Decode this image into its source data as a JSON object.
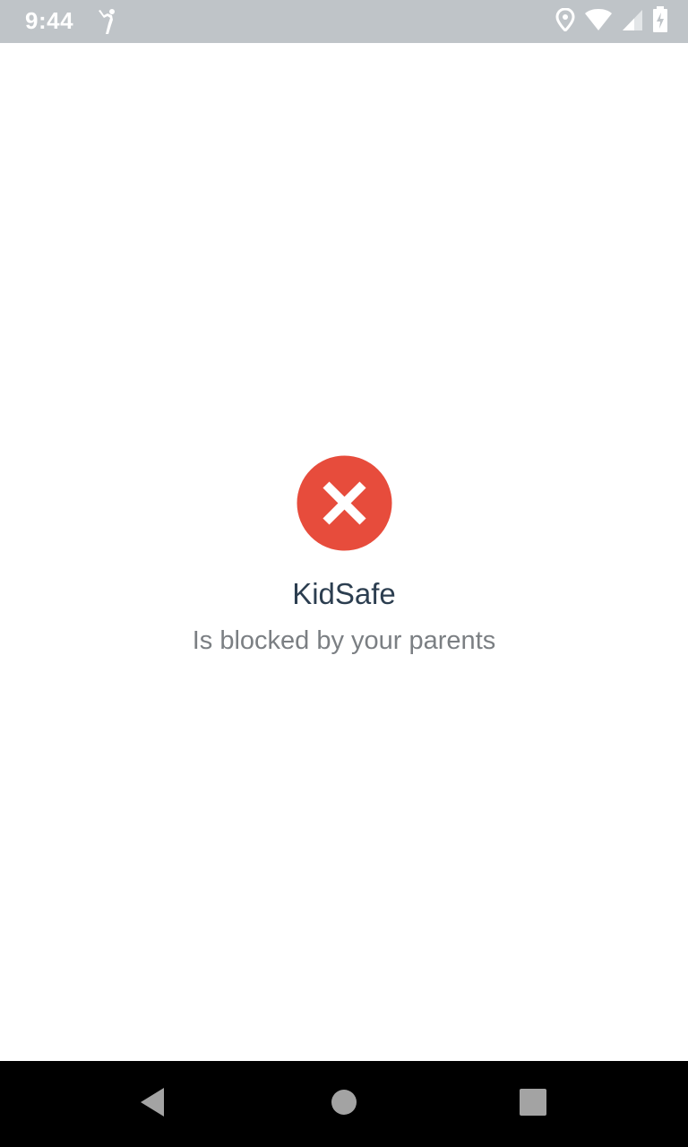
{
  "status_bar": {
    "time": "9:44",
    "icons": [
      "notification-figure-icon",
      "location-icon",
      "wifi-icon",
      "signal-icon",
      "battery-charging-icon"
    ],
    "background_color": "#bfc4c8"
  },
  "blocked_screen": {
    "icon": "blocked-x-icon",
    "icon_color": "#e74c3c",
    "app_name": "KidSafe",
    "message": "Is blocked by your parents"
  },
  "nav_bar": {
    "buttons": [
      "back-icon",
      "home-icon",
      "recents-icon"
    ]
  }
}
